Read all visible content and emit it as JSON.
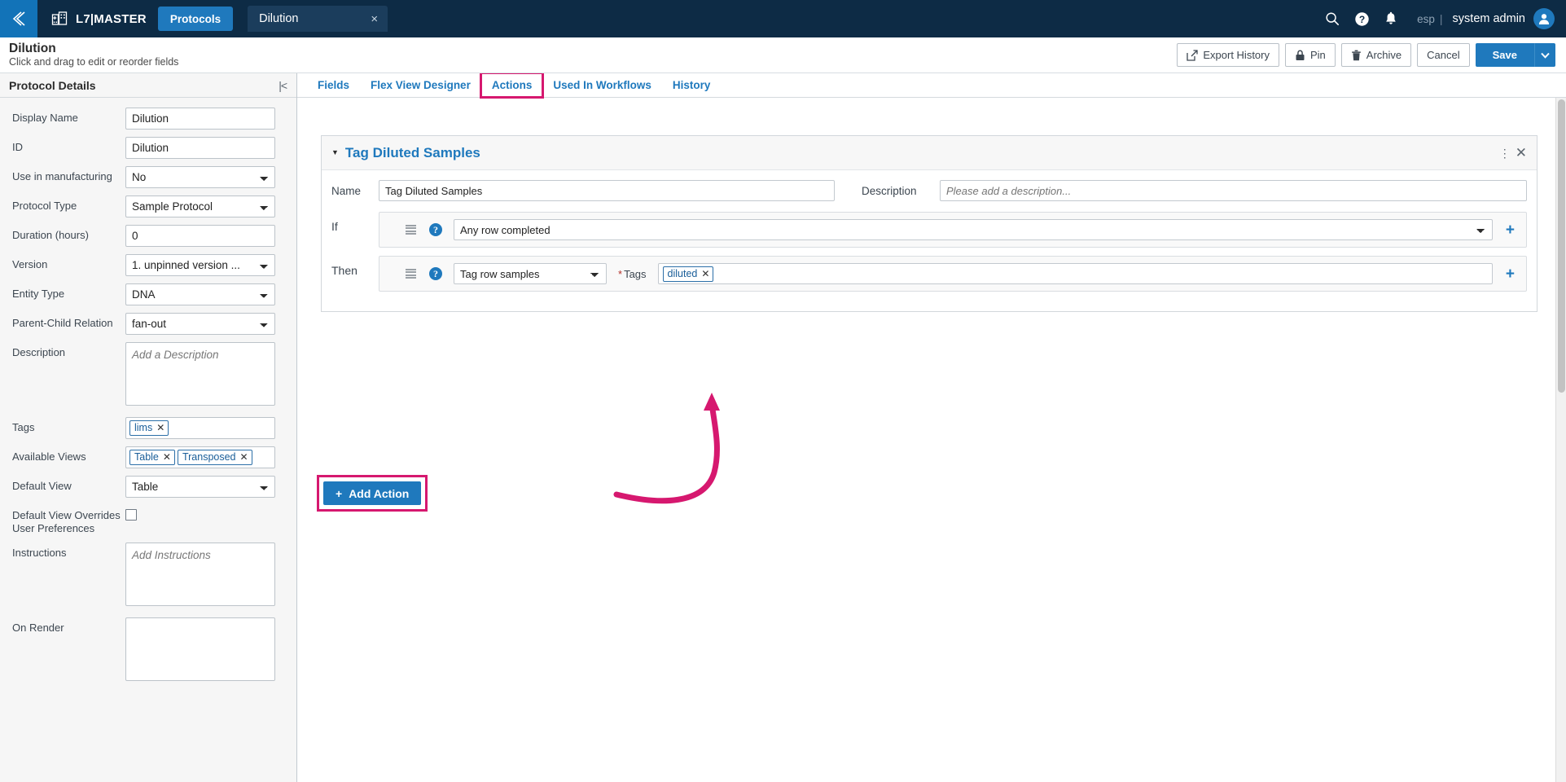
{
  "topnav": {
    "back_icon": "chevron-double-left-icon",
    "app_icon": "building-plus-icon",
    "brand": "L7|MASTER",
    "module_tab": "Protocols",
    "doc_tab": "Dilution",
    "doc_close": "×",
    "icons": [
      "search-icon",
      "help-circle-icon",
      "bell-icon"
    ],
    "org": "esp",
    "separator": "|",
    "user": "system admin",
    "avatar_icon": "user-avatar-icon"
  },
  "pagehead": {
    "title": "Dilution",
    "subtitle": "Click and drag to edit or reorder fields",
    "buttons": [
      {
        "label": "Export History",
        "icon": "external-link-icon"
      },
      {
        "label": "Pin",
        "icon": "lock-icon"
      },
      {
        "label": "Archive",
        "icon": "trash-icon"
      },
      {
        "label": "Cancel",
        "icon": ""
      }
    ],
    "save_label": "Save",
    "save_caret_icon": "chevron-down-icon"
  },
  "sidebar": {
    "title": "Protocol Details",
    "collapse_icon": "collapse-left-icon",
    "fields": [
      {
        "label": "Display Name",
        "type": "text",
        "value": "Dilution"
      },
      {
        "label": "ID",
        "type": "text",
        "value": "Dilution"
      },
      {
        "label": "Use in manufacturing",
        "type": "select",
        "value": "No"
      },
      {
        "label": "Protocol Type",
        "type": "select",
        "value": "Sample Protocol"
      },
      {
        "label": "Duration (hours)",
        "type": "text",
        "value": "0"
      },
      {
        "label": "Version",
        "type": "select",
        "value": "1. unpinned version ..."
      },
      {
        "label": "Entity Type",
        "type": "select",
        "value": "DNA"
      },
      {
        "label": "Parent-Child Relation",
        "type": "select",
        "value": "fan-out"
      },
      {
        "label": "Description",
        "type": "textarea",
        "value": "",
        "placeholder": "Add a Description"
      },
      {
        "label": "Tags",
        "type": "chips",
        "chips": [
          "lims"
        ]
      },
      {
        "label": "Available Views",
        "type": "chips",
        "chips": [
          "Table",
          "Transposed"
        ]
      },
      {
        "label": "Default View",
        "type": "select",
        "value": "Table"
      },
      {
        "label": "Default View Overrides User Preferences",
        "type": "checkbox",
        "checked": false
      },
      {
        "label": "Instructions",
        "type": "textarea",
        "value": "",
        "placeholder": "Add Instructions"
      },
      {
        "label": "On Render",
        "type": "textarea",
        "value": "",
        "placeholder": ""
      }
    ]
  },
  "tabs": [
    {
      "label": "Fields",
      "active": false,
      "highlighted": false
    },
    {
      "label": "Flex View Designer",
      "active": false,
      "highlighted": false
    },
    {
      "label": "Actions",
      "active": true,
      "highlighted": true
    },
    {
      "label": "Used In Workflows",
      "active": false,
      "highlighted": false
    },
    {
      "label": "History",
      "active": false,
      "highlighted": false
    }
  ],
  "action_card": {
    "caret_icon": "caret-down-icon",
    "title": "Tag Diluted Samples",
    "kebab_icon": "more-vertical-icon",
    "close_icon": "close-icon",
    "name_label": "Name",
    "name_value": "Tag Diluted Samples",
    "description_label": "Description",
    "description_value": "",
    "description_placeholder": "Please add a description...",
    "if_label": "If",
    "if_value": "Any row completed",
    "then_label": "Then",
    "then_value": "Tag row samples",
    "tags_label": "Tags",
    "tags_required_marker": "*",
    "tags_chips": [
      "diluted"
    ],
    "add_condition_icon": "plus-icon",
    "add_then_icon": "plus-icon",
    "drag_icon": "drag-handle-icon",
    "help_icon": "help-circle-icon"
  },
  "add_action": {
    "label": "Add Action",
    "icon": "plus-icon"
  },
  "annotation": {
    "highlight_color": "#d6186f",
    "arrow": "curved-arrow-from-add-action-to-action-card"
  }
}
